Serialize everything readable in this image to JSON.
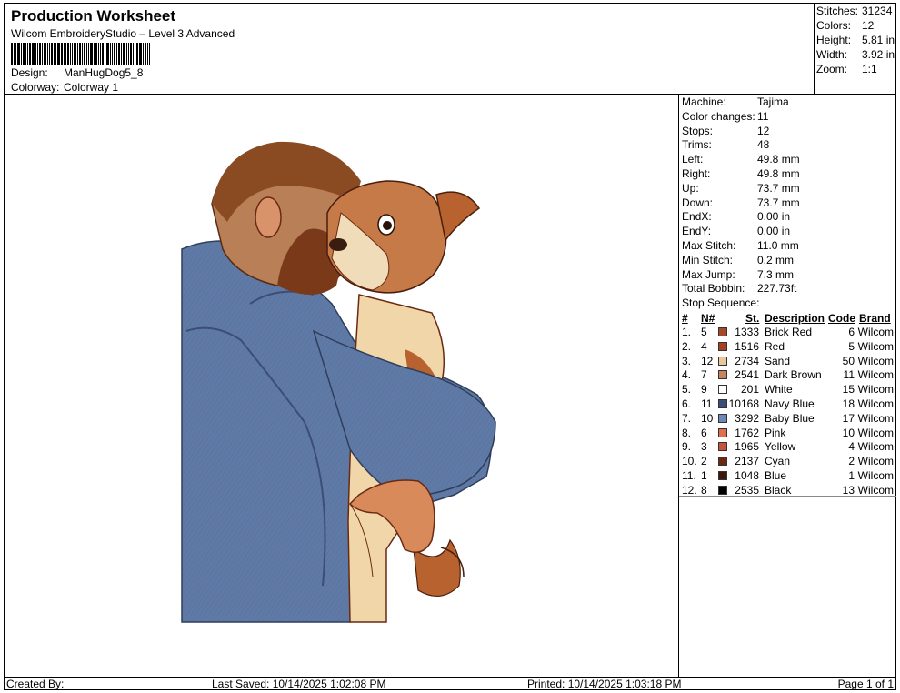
{
  "header": {
    "title": "Production Worksheet",
    "subtitle": "Wilcom EmbroideryStudio – Level 3 Advanced",
    "design_label": "Design:",
    "design_value": "ManHugDog5_8",
    "colorway_label": "Colorway:",
    "colorway_value": "Colorway 1"
  },
  "summary": [
    {
      "label": "Stitches:",
      "value": "31234"
    },
    {
      "label": "Colors:",
      "value": "12"
    },
    {
      "label": "Height:",
      "value": "5.81 in"
    },
    {
      "label": "Width:",
      "value": "3.92 in"
    },
    {
      "label": "Zoom:",
      "value": "1:1"
    }
  ],
  "details": [
    {
      "label": "Machine:",
      "value": "Tajima"
    },
    {
      "label": "Color changes:",
      "value": "11"
    },
    {
      "label": "Stops:",
      "value": "12"
    },
    {
      "label": "Trims:",
      "value": "48"
    },
    {
      "label": "Left:",
      "value": "49.8 mm"
    },
    {
      "label": "Right:",
      "value": "49.8 mm"
    },
    {
      "label": "Up:",
      "value": "73.7 mm"
    },
    {
      "label": "Down:",
      "value": "73.7 mm"
    },
    {
      "label": "EndX:",
      "value": "0.00 in"
    },
    {
      "label": "EndY:",
      "value": "0.00 in"
    },
    {
      "label": "Max Stitch:",
      "value": "11.0 mm"
    },
    {
      "label": "Min Stitch:",
      "value": "0.2 mm"
    },
    {
      "label": "Max Jump:",
      "value": "7.3 mm"
    },
    {
      "label": "Total Bobbin:",
      "value": "227.73ft"
    }
  ],
  "stop_sequence": {
    "title": "Stop Sequence:",
    "headers": {
      "num": "#",
      "needle": "N#",
      "st": "St.",
      "description": "Description",
      "code": "Code",
      "brand": "Brand"
    },
    "rows": [
      {
        "num": "1.",
        "needle": "5",
        "st": "1333",
        "description": "Brick Red",
        "code": "6",
        "brand": "Wilcom",
        "color": "#a4492a"
      },
      {
        "num": "2.",
        "needle": "4",
        "st": "1516",
        "description": "Red",
        "code": "5",
        "brand": "Wilcom",
        "color": "#a8401f"
      },
      {
        "num": "3.",
        "needle": "12",
        "st": "2734",
        "description": "Sand",
        "code": "50",
        "brand": "Wilcom",
        "color": "#e9c79b"
      },
      {
        "num": "4.",
        "needle": "7",
        "st": "2541",
        "description": "Dark Brown",
        "code": "11",
        "brand": "Wilcom",
        "color": "#c8845f"
      },
      {
        "num": "5.",
        "needle": "9",
        "st": "201",
        "description": "White",
        "code": "15",
        "brand": "Wilcom",
        "color": "#ffffff"
      },
      {
        "num": "6.",
        "needle": "11",
        "st": "10168",
        "description": "Navy Blue",
        "code": "18",
        "brand": "Wilcom",
        "color": "#3b4e78"
      },
      {
        "num": "7.",
        "needle": "10",
        "st": "3292",
        "description": "Baby Blue",
        "code": "17",
        "brand": "Wilcom",
        "color": "#6d88b5"
      },
      {
        "num": "8.",
        "needle": "6",
        "st": "1762",
        "description": "Pink",
        "code": "10",
        "brand": "Wilcom",
        "color": "#e0704d"
      },
      {
        "num": "9.",
        "needle": "3",
        "st": "1965",
        "description": "Yellow",
        "code": "4",
        "brand": "Wilcom",
        "color": "#c6543a"
      },
      {
        "num": "10.",
        "needle": "2",
        "st": "2137",
        "description": "Cyan",
        "code": "2",
        "brand": "Wilcom",
        "color": "#6a2a12"
      },
      {
        "num": "11.",
        "needle": "1",
        "st": "1048",
        "description": "Blue",
        "code": "1",
        "brand": "Wilcom",
        "color": "#3d170b"
      },
      {
        "num": "12.",
        "needle": "8",
        "st": "2535",
        "description": "Black",
        "code": "13",
        "brand": "Wilcom",
        "color": "#000000"
      }
    ]
  },
  "footer": {
    "created_by": "Created By:",
    "last_saved": "Last Saved: 10/14/2025 1:02:08 PM",
    "printed": "Printed: 10/14/2025 1:03:18 PM",
    "page": "Page 1 of 1"
  }
}
